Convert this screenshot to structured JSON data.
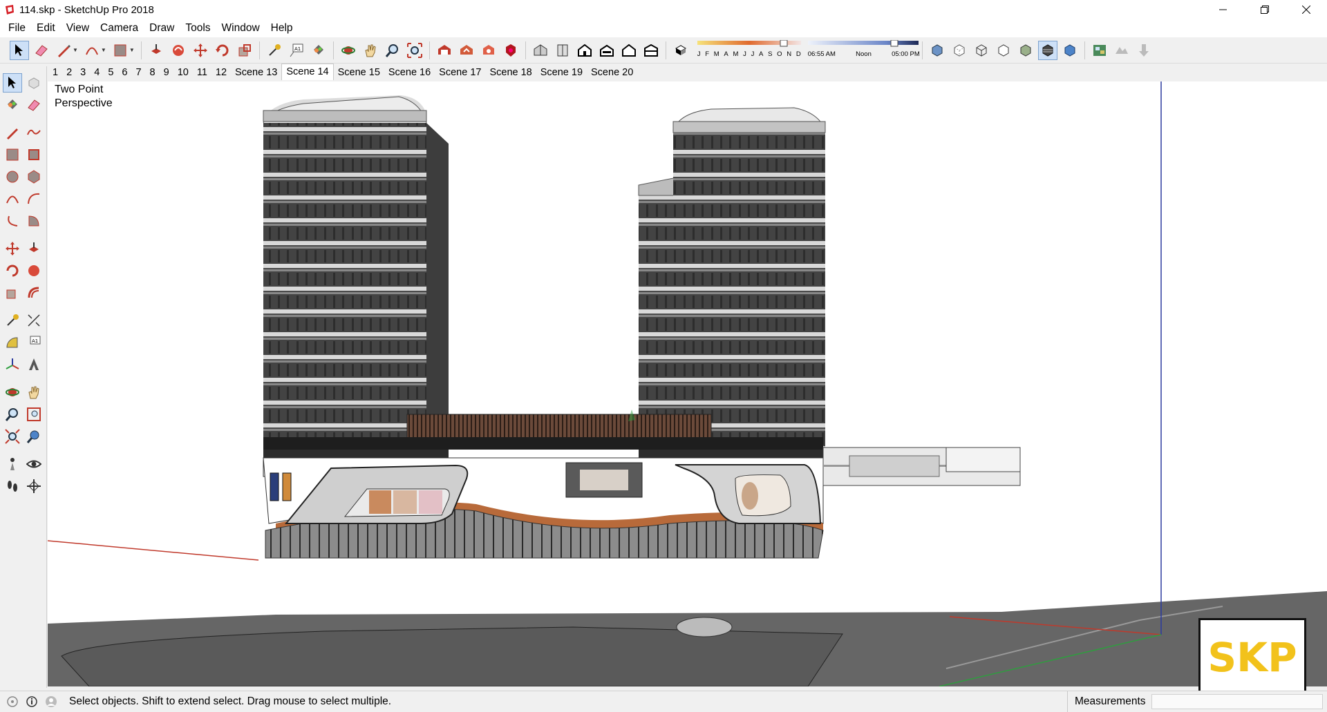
{
  "window": {
    "title": "114.skp - SketchUp Pro 2018"
  },
  "menu": [
    "File",
    "Edit",
    "View",
    "Camera",
    "Draw",
    "Tools",
    "Window",
    "Help"
  ],
  "shadow": {
    "months": [
      "J",
      "F",
      "M",
      "A",
      "M",
      "J",
      "J",
      "A",
      "S",
      "O",
      "N",
      "D"
    ],
    "times": [
      "06:55 AM",
      "Noon",
      "05:00 PM"
    ]
  },
  "scenes": [
    "1",
    "2",
    "3",
    "4",
    "5",
    "6",
    "7",
    "8",
    "9",
    "10",
    "11",
    "12",
    "Scene 13",
    "Scene 14",
    "Scene 15",
    "Scene 16",
    "Scene 17",
    "Scene 18",
    "Scene 19",
    "Scene 20"
  ],
  "active_scene": "Scene 14",
  "viewport": {
    "camera_label_line1": "Two Point",
    "camera_label_line2": "Perspective"
  },
  "status": {
    "hint": "Select objects. Shift to extend select. Drag mouse to select multiple.",
    "measurements_label": "Measurements",
    "measurements_value": ""
  },
  "logo": {
    "text": "SKP"
  },
  "colors": {
    "accent": "#7da2ce",
    "logo_yellow": "#f2c21b",
    "axis_red": "#c0392b",
    "axis_green": "#2e9e3e",
    "axis_blue": "#2b3a9e"
  }
}
